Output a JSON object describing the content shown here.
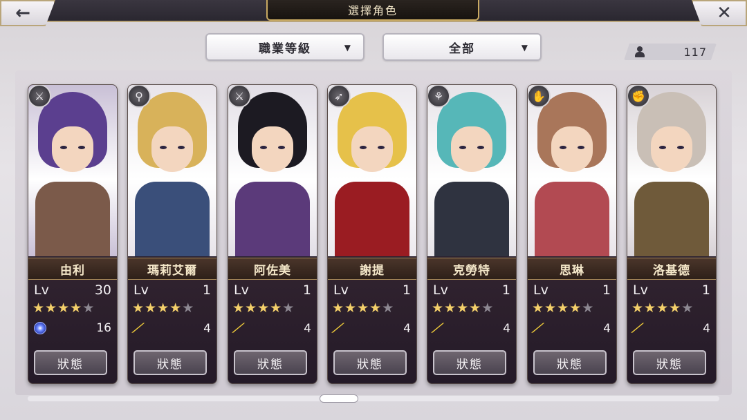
{
  "header": {
    "title": "選擇角色",
    "back_icon": "←",
    "close_icon": "✕"
  },
  "filters": {
    "class_filter": "職業等級",
    "scope_filter": "全部",
    "character_count": "117"
  },
  "characters": [
    {
      "name": "由利",
      "lv_label": "Lv",
      "level": "30",
      "stars": 4,
      "item_value": "16",
      "item_icon": "gem-icon",
      "class_icon": "⚔",
      "status_label": "狀態",
      "colors": {
        "hair": "#5b3f8f",
        "outfit": "#7b5a4a",
        "bg": "#c9c0d6"
      }
    },
    {
      "name": "瑪莉艾爾",
      "lv_label": "Lv",
      "level": "1",
      "stars": 4,
      "item_value": "4",
      "item_icon": "wing-icon",
      "class_icon": "⚲",
      "status_label": "狀態",
      "colors": {
        "hair": "#d8b25a",
        "outfit": "#3a4f7a",
        "bg": "#e8e4ea"
      }
    },
    {
      "name": "阿佐美",
      "lv_label": "Lv",
      "level": "1",
      "stars": 4,
      "item_value": "4",
      "item_icon": "wing-icon",
      "class_icon": "⚔",
      "status_label": "狀態",
      "colors": {
        "hair": "#1c1a22",
        "outfit": "#5b3a7a",
        "bg": "#e2dee6"
      }
    },
    {
      "name": "謝提",
      "lv_label": "Lv",
      "level": "1",
      "stars": 4,
      "item_value": "4",
      "item_icon": "wing-icon",
      "class_icon": "➶",
      "status_label": "狀態",
      "colors": {
        "hair": "#e6c14a",
        "outfit": "#9a1c22",
        "bg": "#ece9ee"
      }
    },
    {
      "name": "克勞特",
      "lv_label": "Lv",
      "level": "1",
      "stars": 4,
      "item_value": "4",
      "item_icon": "wing-icon",
      "class_icon": "⚘",
      "status_label": "狀態",
      "colors": {
        "hair": "#56b7b8",
        "outfit": "#2f3340",
        "bg": "#e6e3e8"
      }
    },
    {
      "name": "思琳",
      "lv_label": "Lv",
      "level": "1",
      "stars": 4,
      "item_value": "4",
      "item_icon": "wing-icon",
      "class_icon": "✋",
      "status_label": "狀態",
      "colors": {
        "hair": "#a9765a",
        "outfit": "#b24a52",
        "bg": "#e9e5ea"
      }
    },
    {
      "name": "洛基德",
      "lv_label": "Lv",
      "level": "1",
      "stars": 4,
      "item_value": "4",
      "item_icon": "wing-icon",
      "class_icon": "✊",
      "status_label": "狀態",
      "colors": {
        "hair": "#c9bfb6",
        "outfit": "#6f5a3a",
        "bg": "#d8d2d6"
      }
    }
  ]
}
